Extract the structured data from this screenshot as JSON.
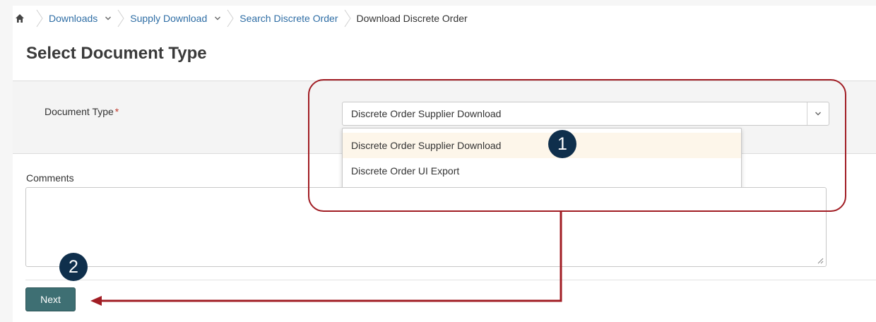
{
  "breadcrumb": {
    "items": [
      {
        "label": "Downloads",
        "has_menu": true
      },
      {
        "label": "Supply Download",
        "has_menu": true
      },
      {
        "label": "Search Discrete Order",
        "has_menu": false
      }
    ],
    "current": "Download Discrete Order"
  },
  "page": {
    "title": "Select Document Type"
  },
  "document_type": {
    "label": "Document Type",
    "required_marker": "*",
    "selected": "Discrete Order Supplier Download",
    "options": [
      "Discrete Order Supplier Download",
      "Discrete Order UI Export"
    ]
  },
  "comments": {
    "label": "Comments",
    "value": ""
  },
  "actions": {
    "next_label": "Next"
  },
  "annotations": {
    "step1": "1",
    "step2": "2",
    "color": "#a11d24",
    "badge_color": "#0f2f4c"
  },
  "colors": {
    "link": "#2f6ea5",
    "button": "#3e6f73",
    "required": "#c0392b"
  }
}
